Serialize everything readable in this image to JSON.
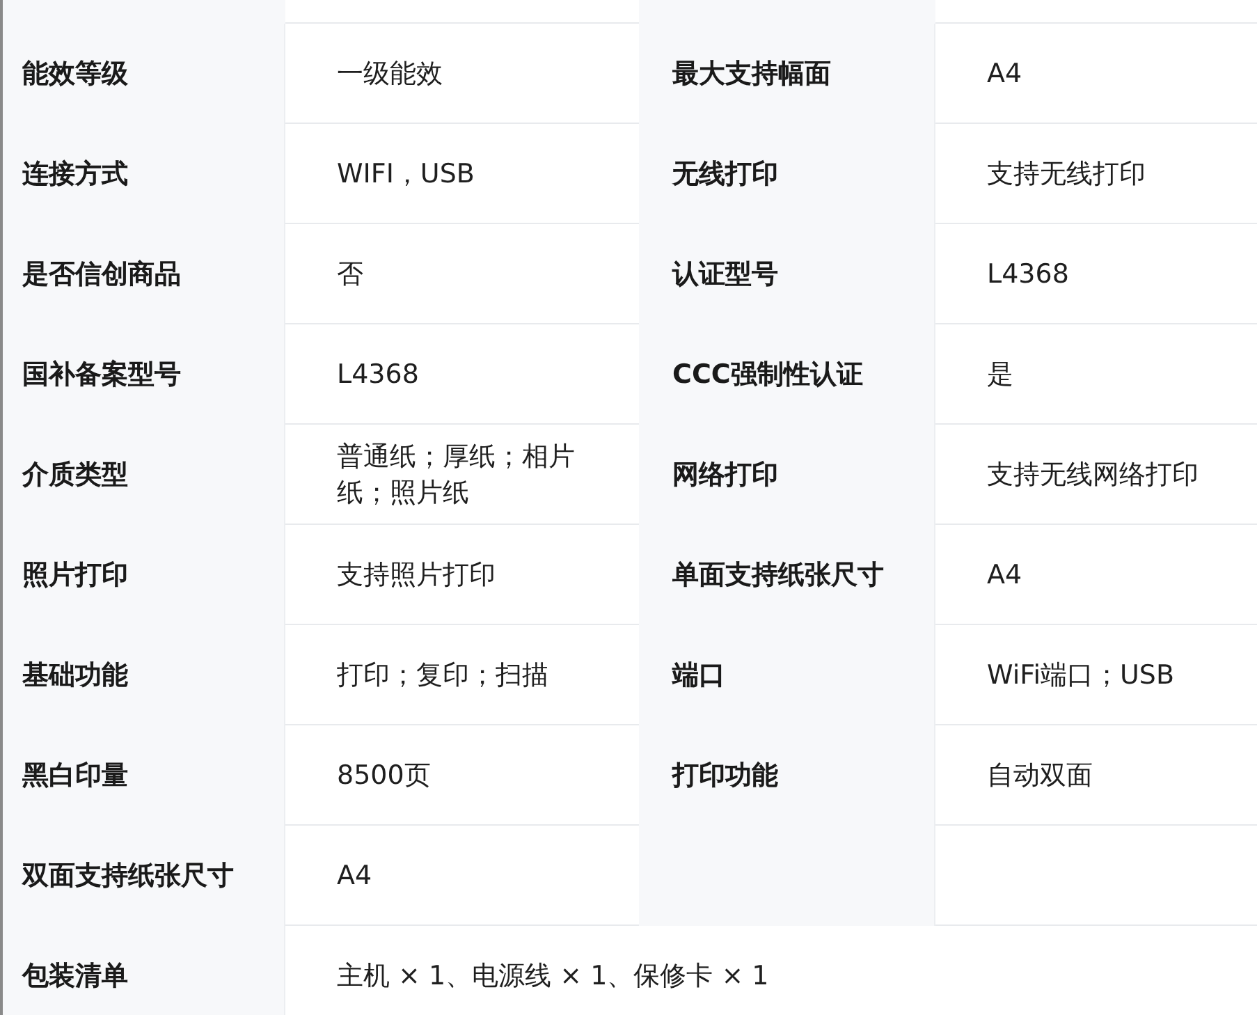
{
  "specs": [
    {
      "kind": "pair",
      "items": [
        {
          "label": "能效等级",
          "value": "一级能效"
        },
        {
          "label": "最大支持幅面",
          "value": "A4"
        }
      ]
    },
    {
      "kind": "pair",
      "items": [
        {
          "label": "连接方式",
          "value": "WIFI，USB"
        },
        {
          "label": "无线打印",
          "value": "支持无线打印"
        }
      ]
    },
    {
      "kind": "pair",
      "items": [
        {
          "label": "是否信创商品",
          "value": "否"
        },
        {
          "label": "认证型号",
          "value": "L4368"
        }
      ]
    },
    {
      "kind": "pair",
      "items": [
        {
          "label": "国补备案型号",
          "value": "L4368"
        },
        {
          "label": "CCC强制性认证",
          "value": "是"
        }
      ]
    },
    {
      "kind": "pair",
      "items": [
        {
          "label": "介质类型",
          "value": "普通纸；厚纸；相片纸；照片纸"
        },
        {
          "label": "网络打印",
          "value": "支持无线网络打印"
        }
      ]
    },
    {
      "kind": "pair",
      "items": [
        {
          "label": "照片打印",
          "value": "支持照片打印"
        },
        {
          "label": "单面支持纸张尺寸",
          "value": "A4"
        }
      ]
    },
    {
      "kind": "pair",
      "items": [
        {
          "label": "基础功能",
          "value": "打印；复印；扫描"
        },
        {
          "label": "端口",
          "value": "WiFi端口；USB"
        }
      ]
    },
    {
      "kind": "pair",
      "items": [
        {
          "label": "黑白印量",
          "value": "8500页"
        },
        {
          "label": "打印功能",
          "value": "自动双面"
        }
      ]
    },
    {
      "kind": "pair",
      "items": [
        {
          "label": "双面支持纸张尺寸",
          "value": "A4"
        }
      ]
    },
    {
      "kind": "wide",
      "items": [
        {
          "label": "包装清单",
          "value": "主机 × 1、电源线 × 1、保修卡 × 1"
        }
      ]
    }
  ]
}
